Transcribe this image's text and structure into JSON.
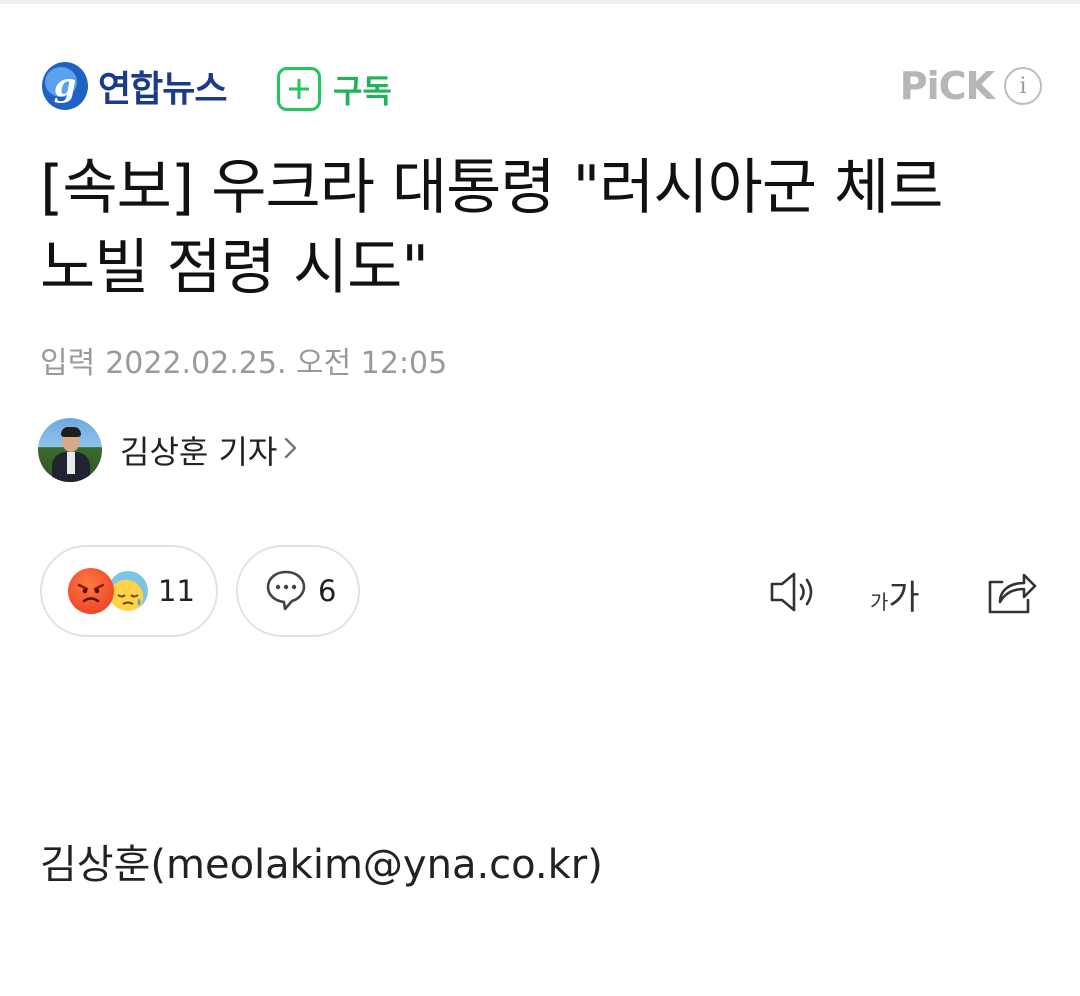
{
  "header": {
    "press_name": "연합뉴스",
    "subscribe_label": "구독",
    "pick_label": "PiCK",
    "info_icon": "i",
    "brand_color": "#1a3a8a",
    "subscribe_color": "#22b35a"
  },
  "article": {
    "headline_line1": "[속보] 우크라 대통령 \"러시아군 체르",
    "headline_line2": "노빌 점령 시도\"",
    "date_label": "입력",
    "date_value": "2022.02.25. 오전 12:05",
    "reporter": "김상훈 기자",
    "body_byline": "김상훈(meolakim@yna.co.kr)"
  },
  "actions": {
    "reaction_count": "11",
    "comment_count": "6",
    "fontsize_small": "가",
    "fontsize_large": "가",
    "icons": [
      "angry-emoji-icon",
      "sad-emoji-icon",
      "comment-icon",
      "speaker-icon",
      "font-size-icon",
      "share-icon"
    ]
  }
}
